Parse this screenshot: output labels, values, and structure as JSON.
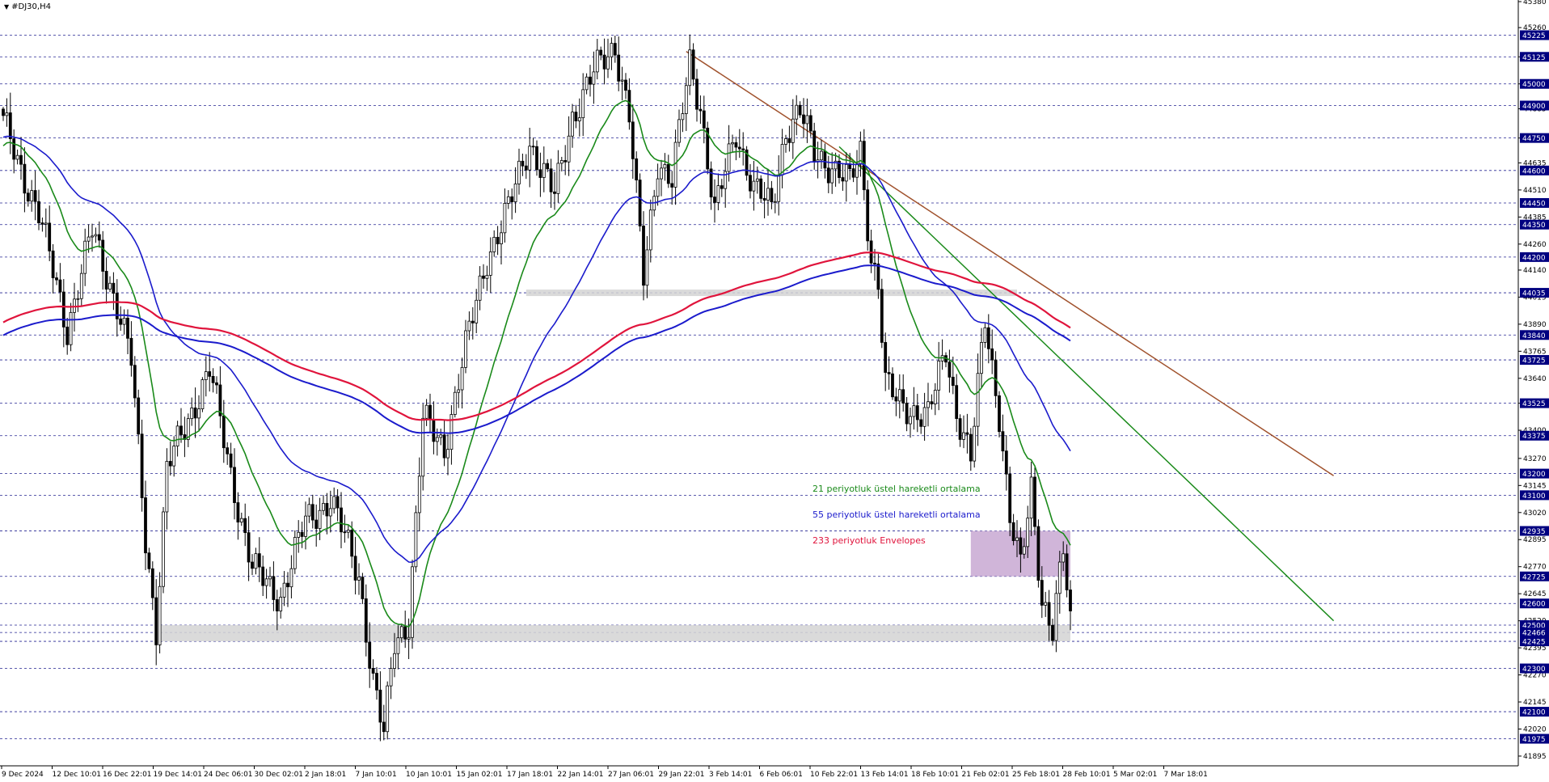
{
  "window": {
    "symbol_timeframe": "#DJ30,H4",
    "menu_icon": "triangle-down-icon"
  },
  "chart_data": {
    "type": "candlestick",
    "ylim": [
      41850,
      45380
    ],
    "y_tick_labels": [
      45380,
      45260,
      45125,
      45000,
      44885,
      44750,
      44635,
      44510,
      44385,
      44260,
      44140,
      44015,
      43890,
      43765,
      43640,
      43525,
      43400,
      43270,
      43145,
      43020,
      42895,
      42770,
      42645,
      42520,
      42395,
      42270,
      42145,
      42020,
      41895
    ],
    "x_tick_labels": [
      "9 Dec 2024",
      "12 Dec 10:01",
      "16 Dec 22:01",
      "19 Dec 14:01",
      "24 Dec 06:01",
      "30 Dec 02:01",
      "2 Jan 18:01",
      "7 Jan 10:01",
      "10 Jan 10:01",
      "15 Jan 02:01",
      "17 Jan 18:01",
      "22 Jan 14:01",
      "27 Jan 06:01",
      "29 Jan 22:01",
      "3 Feb 14:01",
      "6 Feb 06:01",
      "10 Feb 22:01",
      "13 Feb 14:01",
      "18 Feb 10:01",
      "21 Feb 02:01",
      "25 Feb 18:01",
      "28 Feb 10:01",
      "5 Mar 02:01",
      "7 Mar 18:01"
    ],
    "level_lines": [
      45225,
      45125,
      45000,
      44900,
      44750,
      44600,
      44450,
      44350,
      44200,
      44035,
      43840,
      43725,
      43525,
      43375,
      43200,
      43100,
      42935,
      42725,
      42600,
      42500,
      42466,
      42425,
      42300,
      42100,
      41975
    ],
    "highlight_labels": [
      45225,
      45125,
      45000,
      44900,
      44750,
      44600,
      44450,
      44350,
      44200,
      44035,
      43840,
      43725,
      43525,
      43375,
      43200,
      43100,
      42935,
      42725,
      42600,
      42500,
      42466,
      42425,
      42300,
      42100,
      41975
    ],
    "zones": [
      {
        "name": "support-zone",
        "from_idx": 44,
        "to_idx": 300,
        "low": 42425,
        "high": 42500,
        "color": "#d3d3d3"
      },
      {
        "name": "top-resistance-zone",
        "from_idx": 147,
        "to_idx": 285,
        "low": 44020,
        "high": 44050,
        "color": "#d3d3d3"
      },
      {
        "name": "consolidation-zone",
        "from_idx": 272,
        "to_idx": 300,
        "low": 42725,
        "high": 42935,
        "color": "#c8a8d2"
      }
    ],
    "trendlines": [
      {
        "name": "brown-trendline",
        "from_idx": 192,
        "from": 45150,
        "to_idx": 374,
        "to": 43190,
        "color": "#a0522d"
      },
      {
        "name": "green-trendline",
        "from_idx": 235,
        "from": 44710,
        "to_idx": 374,
        "to": 42520,
        "color": "#1a8a1a"
      }
    ],
    "series": [
      {
        "name": "21 periyotluk üstel hareketli ortalama",
        "color": "#1a8a1a",
        "period": 21,
        "kind": "ema"
      },
      {
        "name": "55 periyotluk üstel hareketli ortalama",
        "color": "#1b1bcc",
        "period": 55,
        "kind": "ema"
      },
      {
        "name": "233 periyotluk Envelopes",
        "color": "#e0143c",
        "period": 233,
        "kind": "envelope"
      }
    ],
    "anchors": [
      [
        0,
        44820
      ],
      [
        10,
        44400
      ],
      [
        18,
        43870
      ],
      [
        25,
        44320
      ],
      [
        32,
        43980
      ],
      [
        36,
        43720
      ],
      [
        40,
        42900
      ],
      [
        43,
        42480
      ],
      [
        46,
        43220
      ],
      [
        52,
        43450
      ],
      [
        58,
        43680
      ],
      [
        64,
        43200
      ],
      [
        70,
        42760
      ],
      [
        78,
        42630
      ],
      [
        85,
        42980
      ],
      [
        92,
        43080
      ],
      [
        100,
        42730
      ],
      [
        104,
        42240
      ],
      [
        107,
        41990
      ],
      [
        110,
        42420
      ],
      [
        114,
        42520
      ],
      [
        118,
        43450
      ],
      [
        124,
        43320
      ],
      [
        130,
        43780
      ],
      [
        136,
        44200
      ],
      [
        142,
        44420
      ],
      [
        148,
        44730
      ],
      [
        155,
        44480
      ],
      [
        160,
        44850
      ],
      [
        166,
        45050
      ],
      [
        172,
        45180
      ],
      [
        176,
        44850
      ],
      [
        180,
        44100
      ],
      [
        184,
        44650
      ],
      [
        188,
        44550
      ],
      [
        193,
        45100
      ],
      [
        196,
        44900
      ],
      [
        200,
        44400
      ],
      [
        206,
        44780
      ],
      [
        211,
        44520
      ],
      [
        216,
        44420
      ],
      [
        220,
        44790
      ],
      [
        224,
        44870
      ],
      [
        228,
        44680
      ],
      [
        233,
        44620
      ],
      [
        238,
        44540
      ],
      [
        241,
        44690
      ],
      [
        244,
        44200
      ],
      [
        246,
        44080
      ],
      [
        248,
        43610
      ],
      [
        251,
        43540
      ],
      [
        255,
        43500
      ],
      [
        260,
        43460
      ],
      [
        265,
        43780
      ],
      [
        268,
        43490
      ],
      [
        272,
        43260
      ],
      [
        276,
        43920
      ],
      [
        280,
        43480
      ],
      [
        283,
        42980
      ],
      [
        286,
        42760
      ],
      [
        289,
        43150
      ],
      [
        292,
        42620
      ],
      [
        295,
        42460
      ],
      [
        298,
        42840
      ],
      [
        300,
        42520
      ]
    ]
  },
  "x_axis_last_label_note": ""
}
